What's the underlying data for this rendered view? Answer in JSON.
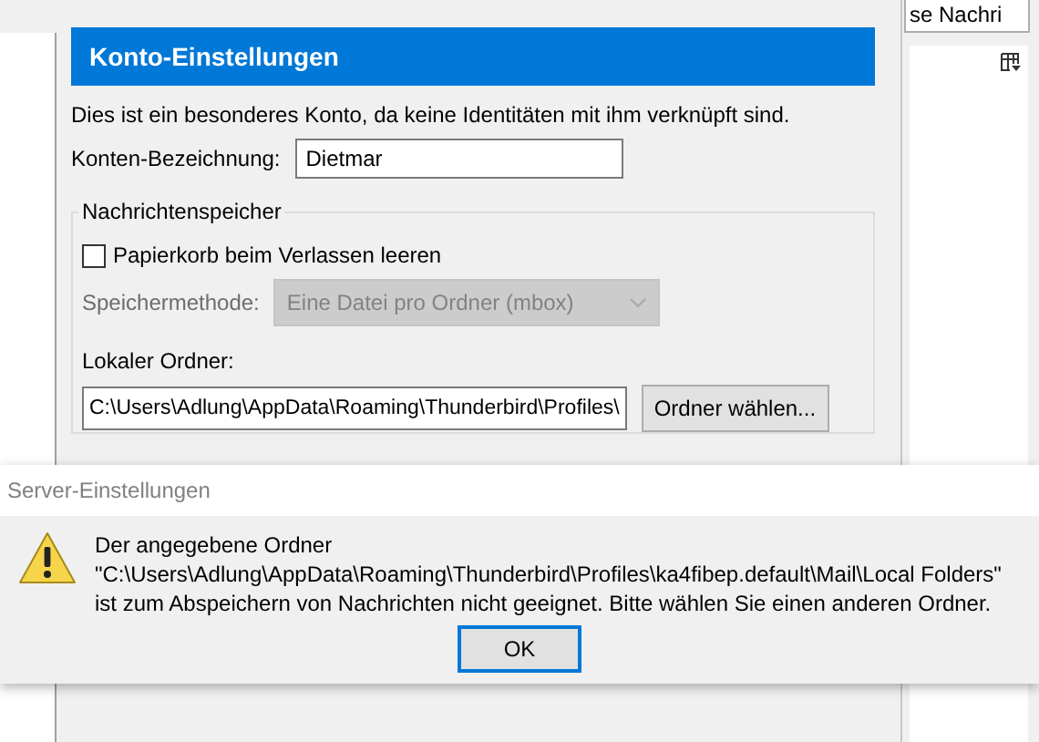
{
  "search_field": {
    "value": "se Nachri"
  },
  "account_settings": {
    "title": "Konto-Einstellungen",
    "description": "Dies ist ein besonderes Konto, da keine Identitäten mit ihm verknüpft sind.",
    "account_name": {
      "label": "Konten-Bezeichnung:",
      "value": "Dietmar"
    },
    "message_store": {
      "legend": "Nachrichtenspeicher",
      "empty_trash": {
        "label": "Papierkorb beim Verlassen leeren",
        "checked": false
      },
      "store_type": {
        "label": "Speichermethode:",
        "value": "Eine Datei pro Ordner (mbox)",
        "disabled": true
      },
      "local_folder": {
        "label": "Lokaler Ordner:",
        "value": "C:\\Users\\Adlung\\AppData\\Roaming\\Thunderbird\\Profiles\\",
        "button": "Ordner wählen..."
      }
    }
  },
  "dialog": {
    "title": "Server-Einstellungen",
    "message": "Der angegebene Ordner \"C:\\Users\\Adlung\\AppData\\Roaming\\Thunderbird\\Profiles\\ka4fibep.default\\Mail\\Local Folders\" ist zum Abspeichern von Nachrichten nicht geeignet. Bitte wählen Sie einen anderen Ordner.",
    "buttons": [
      "OK"
    ]
  }
}
